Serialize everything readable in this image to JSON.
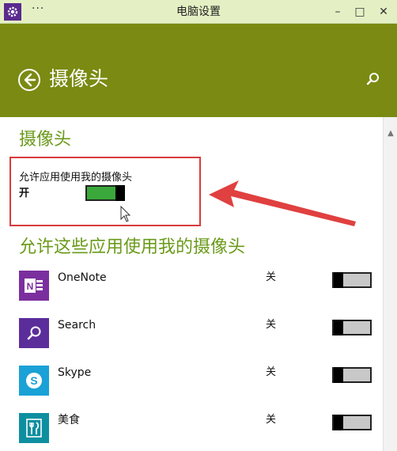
{
  "window": {
    "title": "电脑设置",
    "menu_glyph": "···",
    "min_glyph": "–",
    "max_glyph": "□",
    "close_glyph": "✕"
  },
  "header": {
    "title": "摄像头",
    "bg_color": "#7a8a12"
  },
  "camera": {
    "section_title": "摄像头",
    "allow_label": "允许应用使用我的摄像头",
    "state_label": "开",
    "toggle_on": true
  },
  "apps": {
    "section_title": "允许这些应用使用我的摄像头",
    "items": [
      {
        "name": "OneNote",
        "state": "关",
        "on": false,
        "icon": "onenote-icon",
        "color": "#7b2f9e"
      },
      {
        "name": "Search",
        "state": "关",
        "on": false,
        "icon": "search-icon",
        "color": "#5b2d9b"
      },
      {
        "name": "Skype",
        "state": "关",
        "on": false,
        "icon": "skype-icon",
        "color": "#1aa1d6"
      },
      {
        "name": "美食",
        "state": "关",
        "on": false,
        "icon": "food-icon",
        "color": "#0e8fa0"
      }
    ]
  },
  "accent": {
    "green_text": "#6a9a1a",
    "toggle_on": "#3aa83a",
    "annotation": "#d93a3a"
  }
}
